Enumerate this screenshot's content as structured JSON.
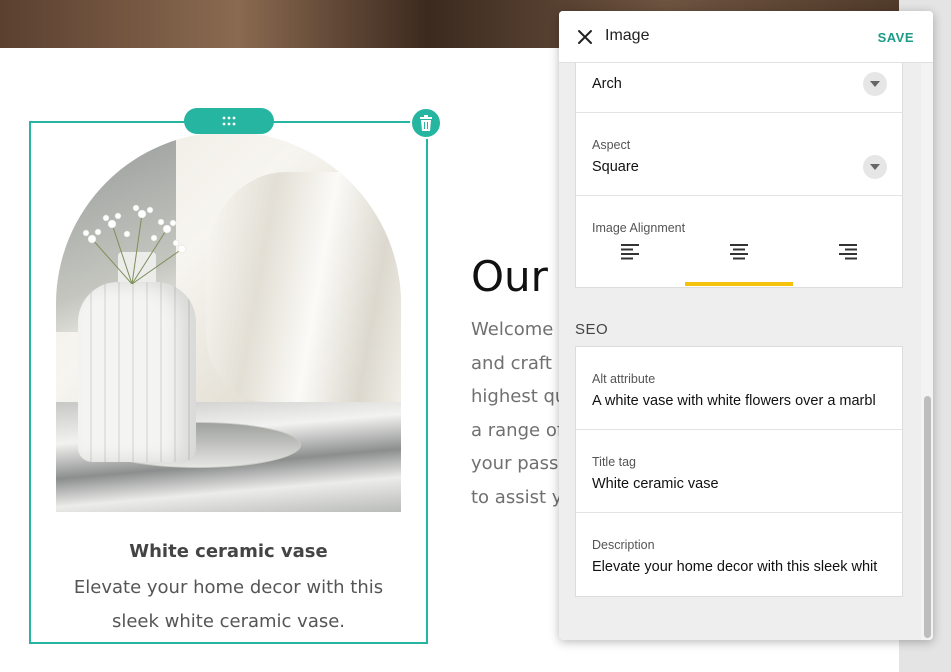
{
  "page": {
    "card": {
      "caption_title": "White ceramic vase",
      "caption_text": "Elevate your home decor with this sleek white ceramic vase."
    },
    "section": {
      "heading": "Our",
      "lines": [
        "Welcome t",
        "and craft n",
        "highest qu",
        "a range of",
        "your passic",
        "to assist yo"
      ]
    }
  },
  "panel": {
    "title": "Image",
    "save_label": "SAVE",
    "shape": {
      "value": "Arch"
    },
    "aspect": {
      "label": "Aspect",
      "value": "Square"
    },
    "alignment": {
      "label": "Image Alignment",
      "selected": "center",
      "options": [
        "left",
        "center",
        "right"
      ]
    },
    "seo": {
      "heading": "SEO",
      "alt": {
        "label": "Alt attribute",
        "value": "A white vase with white flowers over a marbl"
      },
      "title_tag": {
        "label": "Title tag",
        "value": "White ceramic vase"
      },
      "description": {
        "label": "Description",
        "value": "Elevate your home decor with this sleek whit"
      }
    }
  },
  "colors": {
    "accent": "#26b5a0",
    "save": "#1c9c88",
    "alignment_indicator": "#f4c20d"
  },
  "icons": {
    "close": "close-icon",
    "drag": "drag-grid-icon",
    "delete": "trash-icon",
    "dropdown": "chevron-down-icon",
    "align_left": "align-left-icon",
    "align_center": "align-center-icon",
    "align_right": "align-right-icon"
  }
}
